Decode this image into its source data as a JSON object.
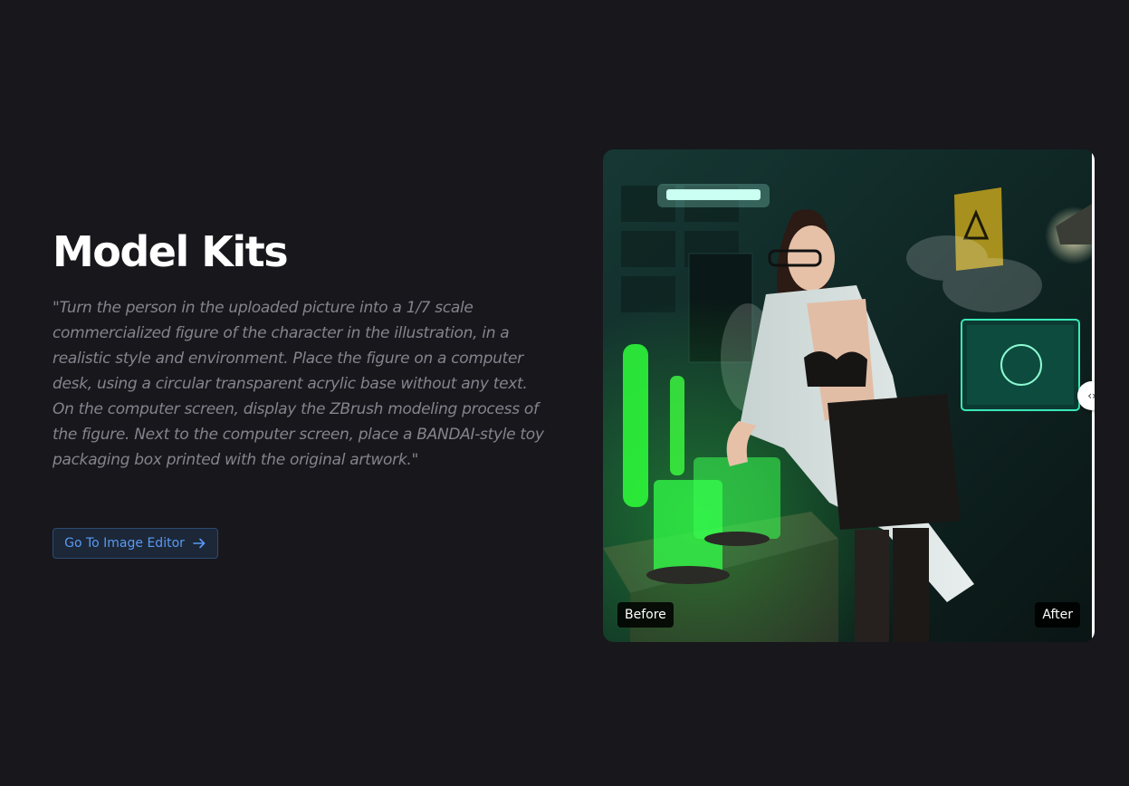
{
  "section": {
    "title": "Model Kits",
    "description": "\"Turn the person in the uploaded picture into a 1/7 scale commercialized figure of the character in the illustration, in a realistic style and environment. Place the figure on a computer desk, using a circular transparent acrylic base without any text. On the computer screen, display the ZBrush modeling process of the figure. Next to the computer screen, place a BANDAI-style toy packaging box printed with the original artwork.\"",
    "cta_label": "Go To Image Editor",
    "cta_icon": "arrow-right-icon"
  },
  "comparison": {
    "before_label": "Before",
    "after_label": "After",
    "handle_glyph": "‹›",
    "handle_position": 0.995
  },
  "colors": {
    "background": "#18171c",
    "accent": "#5a9af3",
    "text_muted": "#85838c",
    "glow_green": "#39ff4a"
  }
}
